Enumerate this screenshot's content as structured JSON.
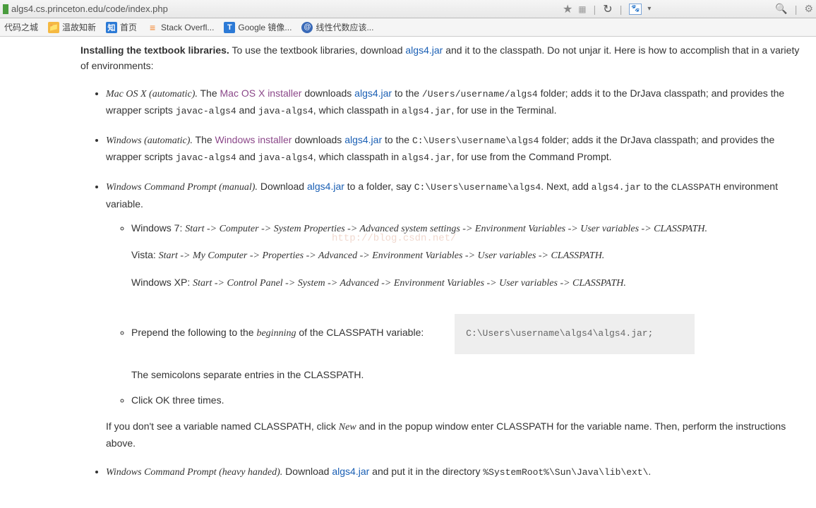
{
  "chrome": {
    "url": "algs4.cs.princeton.edu/code/index.php",
    "icons": {
      "star": "★",
      "qr": "▦",
      "reload": "↻",
      "paw": "🐾",
      "dropdown": "▾",
      "search": "🔍",
      "gear": "⚙"
    }
  },
  "bookmarks": [
    {
      "label": "代码之城"
    },
    {
      "label": "温故知新"
    },
    {
      "label": "首页"
    },
    {
      "label": "Stack Overfl..."
    },
    {
      "label": "Google 镜像..."
    },
    {
      "label": "线性代数应该..."
    }
  ],
  "intro": {
    "bold": "Installing the textbook libraries.",
    "pre": " To use the textbook libraries, download ",
    "link1": "algs4.jar",
    "post": " and it to the classpath. Do not unjar it. Here is how to accomplish that in a variety of environments:"
  },
  "macosx": {
    "title": "Mac OS X (automatic).",
    "t1": " The ",
    "link_installer": "Mac OS X installer",
    "t2": " downloads ",
    "link_jar": "algs4.jar",
    "t3": " to the ",
    "path": "/Users/username/algs4",
    "t4": " folder; adds it to the DrJava classpath; and provides the wrapper scripts ",
    "s1": "javac-algs4",
    "t5": " and ",
    "s2": "java-algs4",
    "t6": ", which classpath in ",
    "s3": "algs4.jar",
    "t7": ", for use in the Terminal."
  },
  "winauto": {
    "title": "Windows (automatic).",
    "t1": " The ",
    "link_installer": "Windows installer",
    "t2": " downloads ",
    "link_jar": "algs4.jar",
    "t3": " to the ",
    "path": "C:\\Users\\username\\algs4",
    "t4": " folder; adds it the DrJava classpath; and provides the wrapper scripts ",
    "s1": "javac-algs4",
    "t5": " and ",
    "s2": "java-algs4",
    "t6": ", which classpath in ",
    "s3": "algs4.jar",
    "t7": ", for use from the Command Prompt."
  },
  "wincmdman": {
    "title": "Windows Command Prompt (manual).",
    "t1": " Download ",
    "link_jar": "algs4.jar",
    "t2": " to a folder, say ",
    "path1": "C:\\Users\\username\\algs4",
    "t3": ". Next, add ",
    "s1": "algs4.jar",
    "t4": " to the ",
    "s2": "CLASSPATH",
    "t5": " environment variable."
  },
  "win7": {
    "label": "Windows 7: ",
    "steps": "Start -> Computer -> System Properties -> Advanced system settings -> Environment Variables -> User variables -> CLASSPATH."
  },
  "vista": {
    "label": "Vista: ",
    "steps": "Start -> My Computer -> Properties -> Advanced -> Environment Variables -> User variables -> CLASSPATH."
  },
  "winxp": {
    "label": "Windows XP: ",
    "steps": "Start -> Control Panel -> System -> Advanced -> Environment Variables -> User variables -> CLASSPATH."
  },
  "prepend": {
    "t1": "Prepend the following to the ",
    "em": "beginning",
    "t2": " of the CLASSPATH variable:",
    "code": "C:\\Users\\username\\algs4\\algs4.jar;",
    "note": "The semicolons separate entries in the CLASSPATH."
  },
  "clickok": "Click OK three times.",
  "noclasspath": {
    "t1": "If you don't see a variable named CLASSPATH, click ",
    "em": "New",
    "t2": " and in the popup window enter CLASSPATH for the variable name. Then, perform the instructions above."
  },
  "winheavy": {
    "title": "Windows Command Prompt (heavy handed).",
    "t1": " Download ",
    "link_jar": "algs4.jar",
    "t2": " and put it in the directory ",
    "path": "%SystemRoot%\\Sun\\Java\\lib\\ext\\",
    "t3": "."
  },
  "watermark": "http://blog.csdn.net/"
}
